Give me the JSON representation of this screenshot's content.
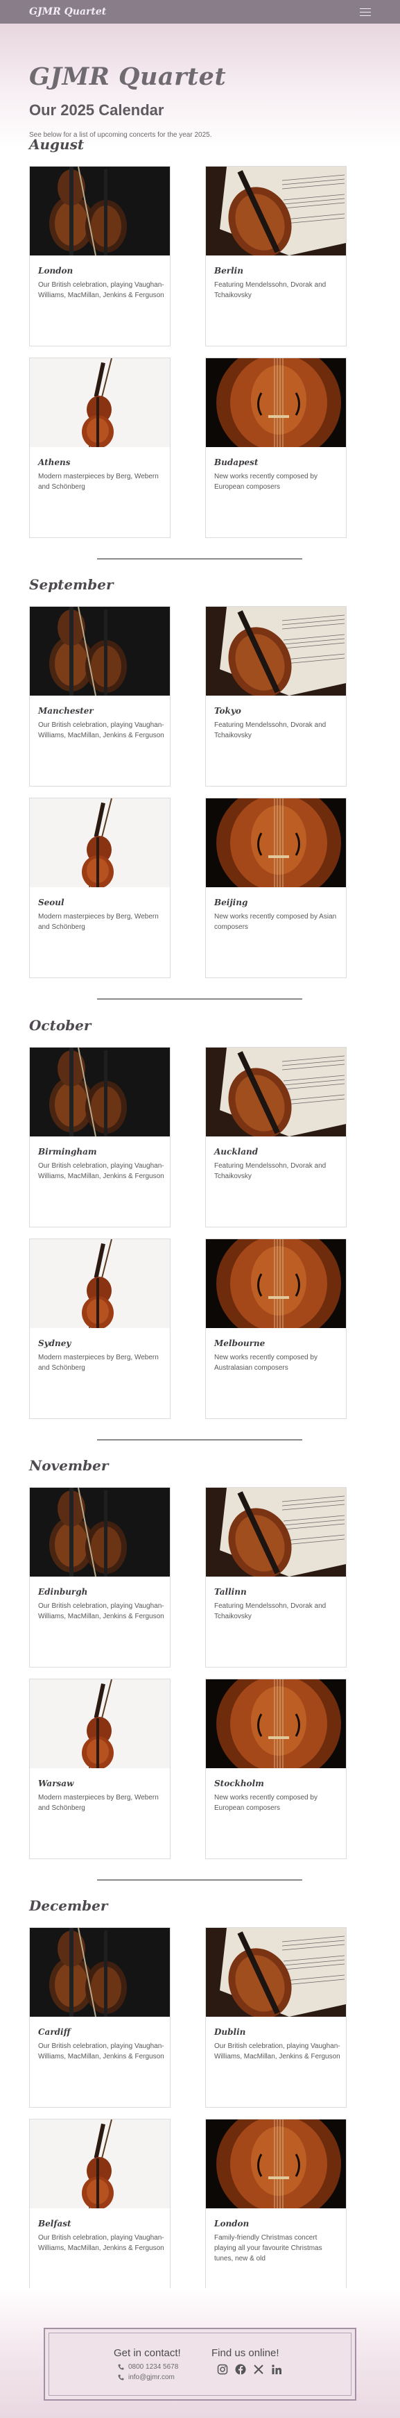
{
  "nav": {
    "brand": "GJMR Quartet",
    "menu_icon": "hamburger-icon"
  },
  "header": {
    "title": "GJMR Quartet",
    "subtitle": "Our 2025 Calendar",
    "intro": "See below for a list of upcoming concerts for the year 2025."
  },
  "months": [
    {
      "name": "August",
      "events": [
        {
          "city": "London",
          "description": "Our British celebration, playing Vaughan-Williams, MacMillan, Jenkins & Ferguson",
          "image": "violin-dark"
        },
        {
          "city": "Berlin",
          "description": "Featuring Mendelssohn, Dvorak and Tchaikovsky",
          "image": "violin-sheet-music"
        },
        {
          "city": "Athens",
          "description": "Modern masterpieces by Berg, Webern and Schönberg",
          "image": "violin-bow-white"
        },
        {
          "city": "Budapest",
          "description": "New works recently composed by European composers",
          "image": "violin-closeup"
        }
      ]
    },
    {
      "name": "September",
      "events": [
        {
          "city": "Manchester",
          "description": "Our British celebration, playing Vaughan-Williams, MacMillan, Jenkins & Ferguson",
          "image": "violin-dark"
        },
        {
          "city": "Tokyo",
          "description": "Featuring Mendelssohn, Dvorak and Tchaikovsky",
          "image": "violin-sheet-music"
        },
        {
          "city": "Seoul",
          "description": "Modern masterpieces by Berg, Webern and Schönberg",
          "image": "violin-bow-white"
        },
        {
          "city": "Beijing",
          "description": "New works recently composed by Asian composers",
          "image": "violin-closeup"
        }
      ]
    },
    {
      "name": "October",
      "events": [
        {
          "city": "Birmingham",
          "description": "Our British celebration, playing Vaughan-Williams, MacMillan, Jenkins & Ferguson",
          "image": "violin-dark"
        },
        {
          "city": "Auckland",
          "description": "Featuring Mendelssohn, Dvorak and Tchaikovsky",
          "image": "violin-sheet-music"
        },
        {
          "city": "Sydney",
          "description": "Modern masterpieces by Berg, Webern and Schönberg",
          "image": "violin-bow-white"
        },
        {
          "city": "Melbourne",
          "description": "New works recently composed by Australasian composers",
          "image": "violin-closeup"
        }
      ]
    },
    {
      "name": "November",
      "events": [
        {
          "city": "Edinburgh",
          "description": "Our British celebration, playing Vaughan-Williams, MacMillan, Jenkins & Ferguson",
          "image": "violin-dark"
        },
        {
          "city": "Tallinn",
          "description": "Featuring Mendelssohn, Dvorak and Tchaikovsky",
          "image": "violin-sheet-music"
        },
        {
          "city": "Warsaw",
          "description": "Modern masterpieces by Berg, Webern and Schönberg",
          "image": "violin-bow-white"
        },
        {
          "city": "Stockholm",
          "description": "New works recently composed by European composers",
          "image": "violin-closeup"
        }
      ]
    },
    {
      "name": "December",
      "events": [
        {
          "city": "Cardiff",
          "description": "Our British celebration, playing Vaughan-Williams, MacMillan, Jenkins & Ferguson",
          "image": "violin-dark"
        },
        {
          "city": "Dublin",
          "description": "Our British celebration, playing Vaughan-Williams, MacMillan, Jenkins & Ferguson",
          "image": "violin-sheet-music"
        },
        {
          "city": "Belfast",
          "description": "Our British celebration, playing Vaughan-Williams, MacMillan, Jenkins & Ferguson",
          "image": "violin-bow-white"
        },
        {
          "city": "London",
          "description": "Family-friendly Christmas concert playing all your favourite Christmas tunes, new & old",
          "image": "violin-closeup"
        }
      ]
    }
  ],
  "footer": {
    "contact_heading": "Get in contact!",
    "phone": "0800 1234 5678",
    "email": "info@gjmr.com",
    "online_heading": "Find us online!",
    "social_icons": [
      "instagram-icon",
      "facebook-icon",
      "x-icon",
      "linkedin-icon"
    ]
  },
  "colors": {
    "navbar": "#8a7d8a",
    "header_gradient_top": "#e8d6df",
    "footer_border": "#a58fa5",
    "footer_box": "#efe2e9"
  }
}
